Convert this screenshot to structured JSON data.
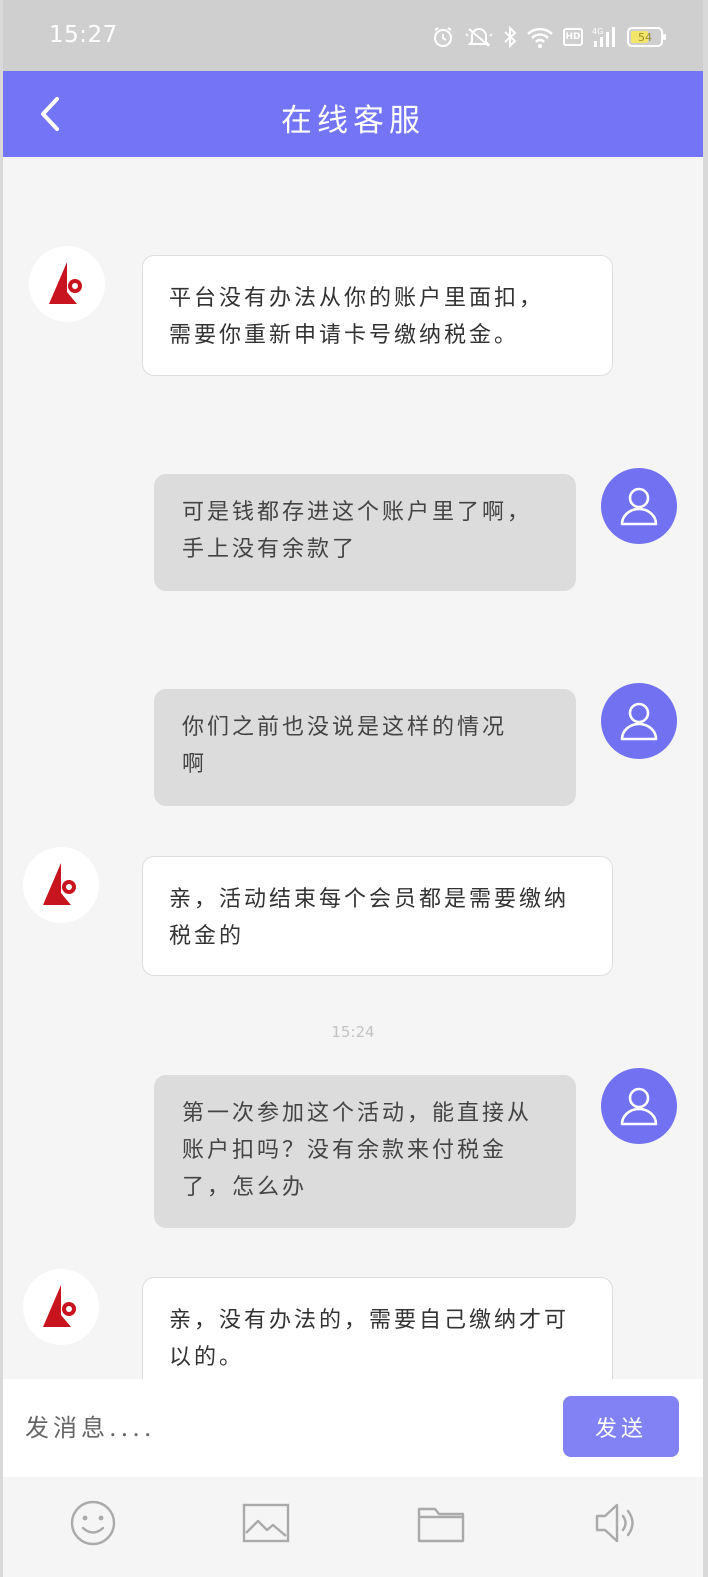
{
  "status_bar": {
    "time": "15:27",
    "battery": "54",
    "battery_level": 0.54,
    "network_label": "4G",
    "hd_label": "HD",
    "icons": [
      "alarm-icon",
      "mute-icon",
      "bluetooth-icon",
      "wifi-icon",
      "hd-icon",
      "signal-icon",
      "battery-icon"
    ]
  },
  "header": {
    "title": "在线客服",
    "back_icon": "chevron-left-icon",
    "color": "#7474f7"
  },
  "messages": [
    {
      "sender": "agent",
      "avatar_icon": "brand-logo-icon",
      "lines": [
        "平台没有办法从你的账户里面扣，",
        "需要你重新申请卡号缴纳税金。"
      ]
    },
    {
      "sender": "user",
      "avatar_icon": "user-icon",
      "lines": [
        "可是钱都存进这个账户里了啊，",
        "手上没有余款了"
      ]
    },
    {
      "sender": "user",
      "avatar_icon": "user-icon",
      "lines": [
        "你们之前也没说是这样的情况",
        "啊"
      ]
    },
    {
      "sender": "agent",
      "avatar_icon": "brand-logo-icon",
      "lines": [
        "亲，活动结束每个会员都是需要缴纳",
        "税金的"
      ]
    },
    {
      "type": "timestamp",
      "text": "15:24"
    },
    {
      "sender": "user",
      "avatar_icon": "user-icon",
      "lines": [
        "第一次参加这个活动，能直接从",
        "账户扣吗？没有余款来付税金",
        "了，怎么办"
      ]
    },
    {
      "sender": "agent",
      "avatar_icon": "brand-logo-icon",
      "lines": [
        "亲，没有办法的，需要自己缴纳才可",
        "以的。"
      ]
    }
  ],
  "composer": {
    "placeholder": "发消息....",
    "send_label": "发送"
  },
  "toolbar": {
    "items": [
      "emoji-icon",
      "image-icon",
      "folder-icon",
      "speaker-icon"
    ]
  },
  "colors": {
    "accent": "#7474f7",
    "user_bubble": "#dcdcdc",
    "agent_bubble": "#ffffff",
    "logo_red": "#c8141e"
  }
}
